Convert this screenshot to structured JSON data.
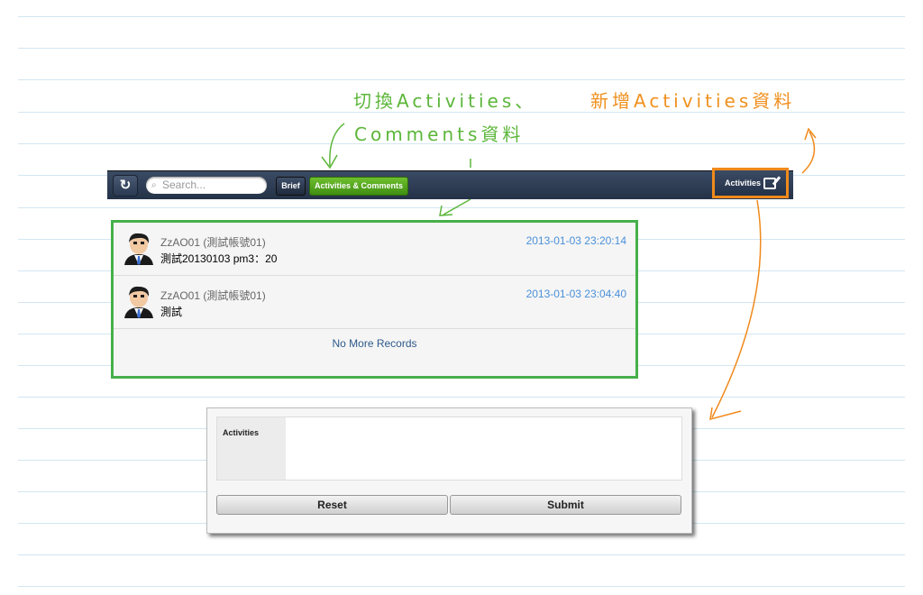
{
  "annotations": {
    "switch_line1": "切換Activities、",
    "switch_line2": "Comments資料",
    "add_text": "新增Activities資料"
  },
  "toolbar": {
    "search_placeholder": "Search...",
    "brief_label": "Brief",
    "activities_comments_label": "Activities & Comments",
    "activities_button_label": "Activities"
  },
  "records": [
    {
      "user": "ZzAO01 (測試帳號01)",
      "text": "測試20130103 pm3：20",
      "time": "2013-01-03 23:20:14"
    },
    {
      "user": "ZzAO01 (測試帳號01)",
      "text": "測試",
      "time": "2013-01-03 23:04:40"
    }
  ],
  "no_more": "No More Records",
  "form": {
    "field_label": "Activities",
    "reset_label": "Reset",
    "submit_label": "Submit"
  },
  "colors": {
    "annotation_orange": "#f0901e",
    "annotation_green": "#5cb63a",
    "toolbar": "#2d3c54",
    "timestamp": "#4a90d9"
  }
}
